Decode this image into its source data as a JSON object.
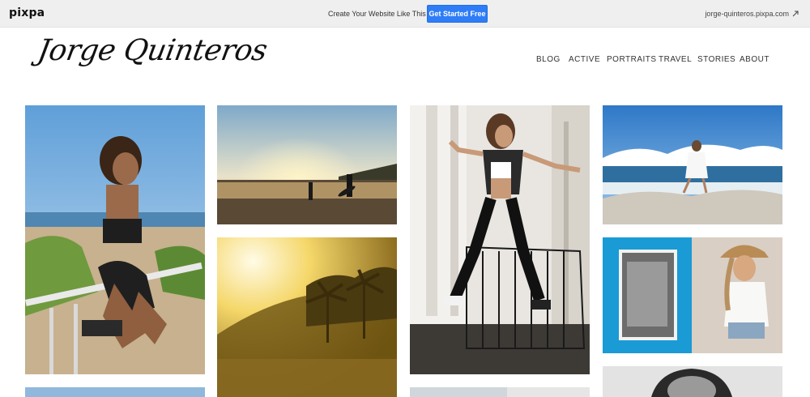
{
  "topbar": {
    "brand": "pixpa",
    "promo_text": "Create Your Website Like This",
    "cta_label": "Get Started Free",
    "site_url": "jorge-quinteros.pixpa.com",
    "external_icon": "external-link-icon"
  },
  "header": {
    "logo_text": "Jorge Quinteros",
    "nav": [
      "BLOG",
      "ACTIVE",
      "PORTRAITS",
      "TRAVEL",
      "STORIES",
      "ABOUT"
    ]
  },
  "gallery": {
    "photos": [
      "beach-woman-railing",
      "sunset-surfer",
      "woman-jumping",
      "beach-woman-rocks",
      "golden-palms",
      "woman-hat-portrait",
      "partial-bottom-1",
      "partial-bottom-3",
      "bw-portrait-partial"
    ]
  }
}
